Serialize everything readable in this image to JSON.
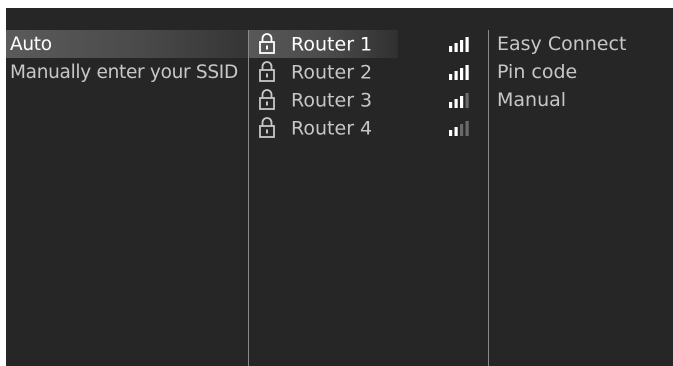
{
  "methods": [
    {
      "label": "Auto",
      "selected": true
    },
    {
      "label": "Manually enter your SSID",
      "selected": false
    }
  ],
  "routers": [
    {
      "label": "Router 1",
      "selected": true,
      "signal_bars": 4,
      "icon": "lock-icon"
    },
    {
      "label": "Router 2",
      "selected": false,
      "signal_bars": 4,
      "icon": "lock-icon"
    },
    {
      "label": "Router 3",
      "selected": false,
      "signal_bars": 3,
      "icon": "lock-icon"
    },
    {
      "label": "Router 4",
      "selected": false,
      "signal_bars": 2,
      "icon": "lock-icon"
    }
  ],
  "connection_options": [
    {
      "label": "Easy Connect"
    },
    {
      "label": "Pin code"
    },
    {
      "label": "Manual"
    }
  ],
  "colors": {
    "background": "#262626",
    "text": "#c7c7c7",
    "text_selected": "#ffffff",
    "signal_active": "#ffffff",
    "signal_inactive": "#6a6a6a"
  }
}
